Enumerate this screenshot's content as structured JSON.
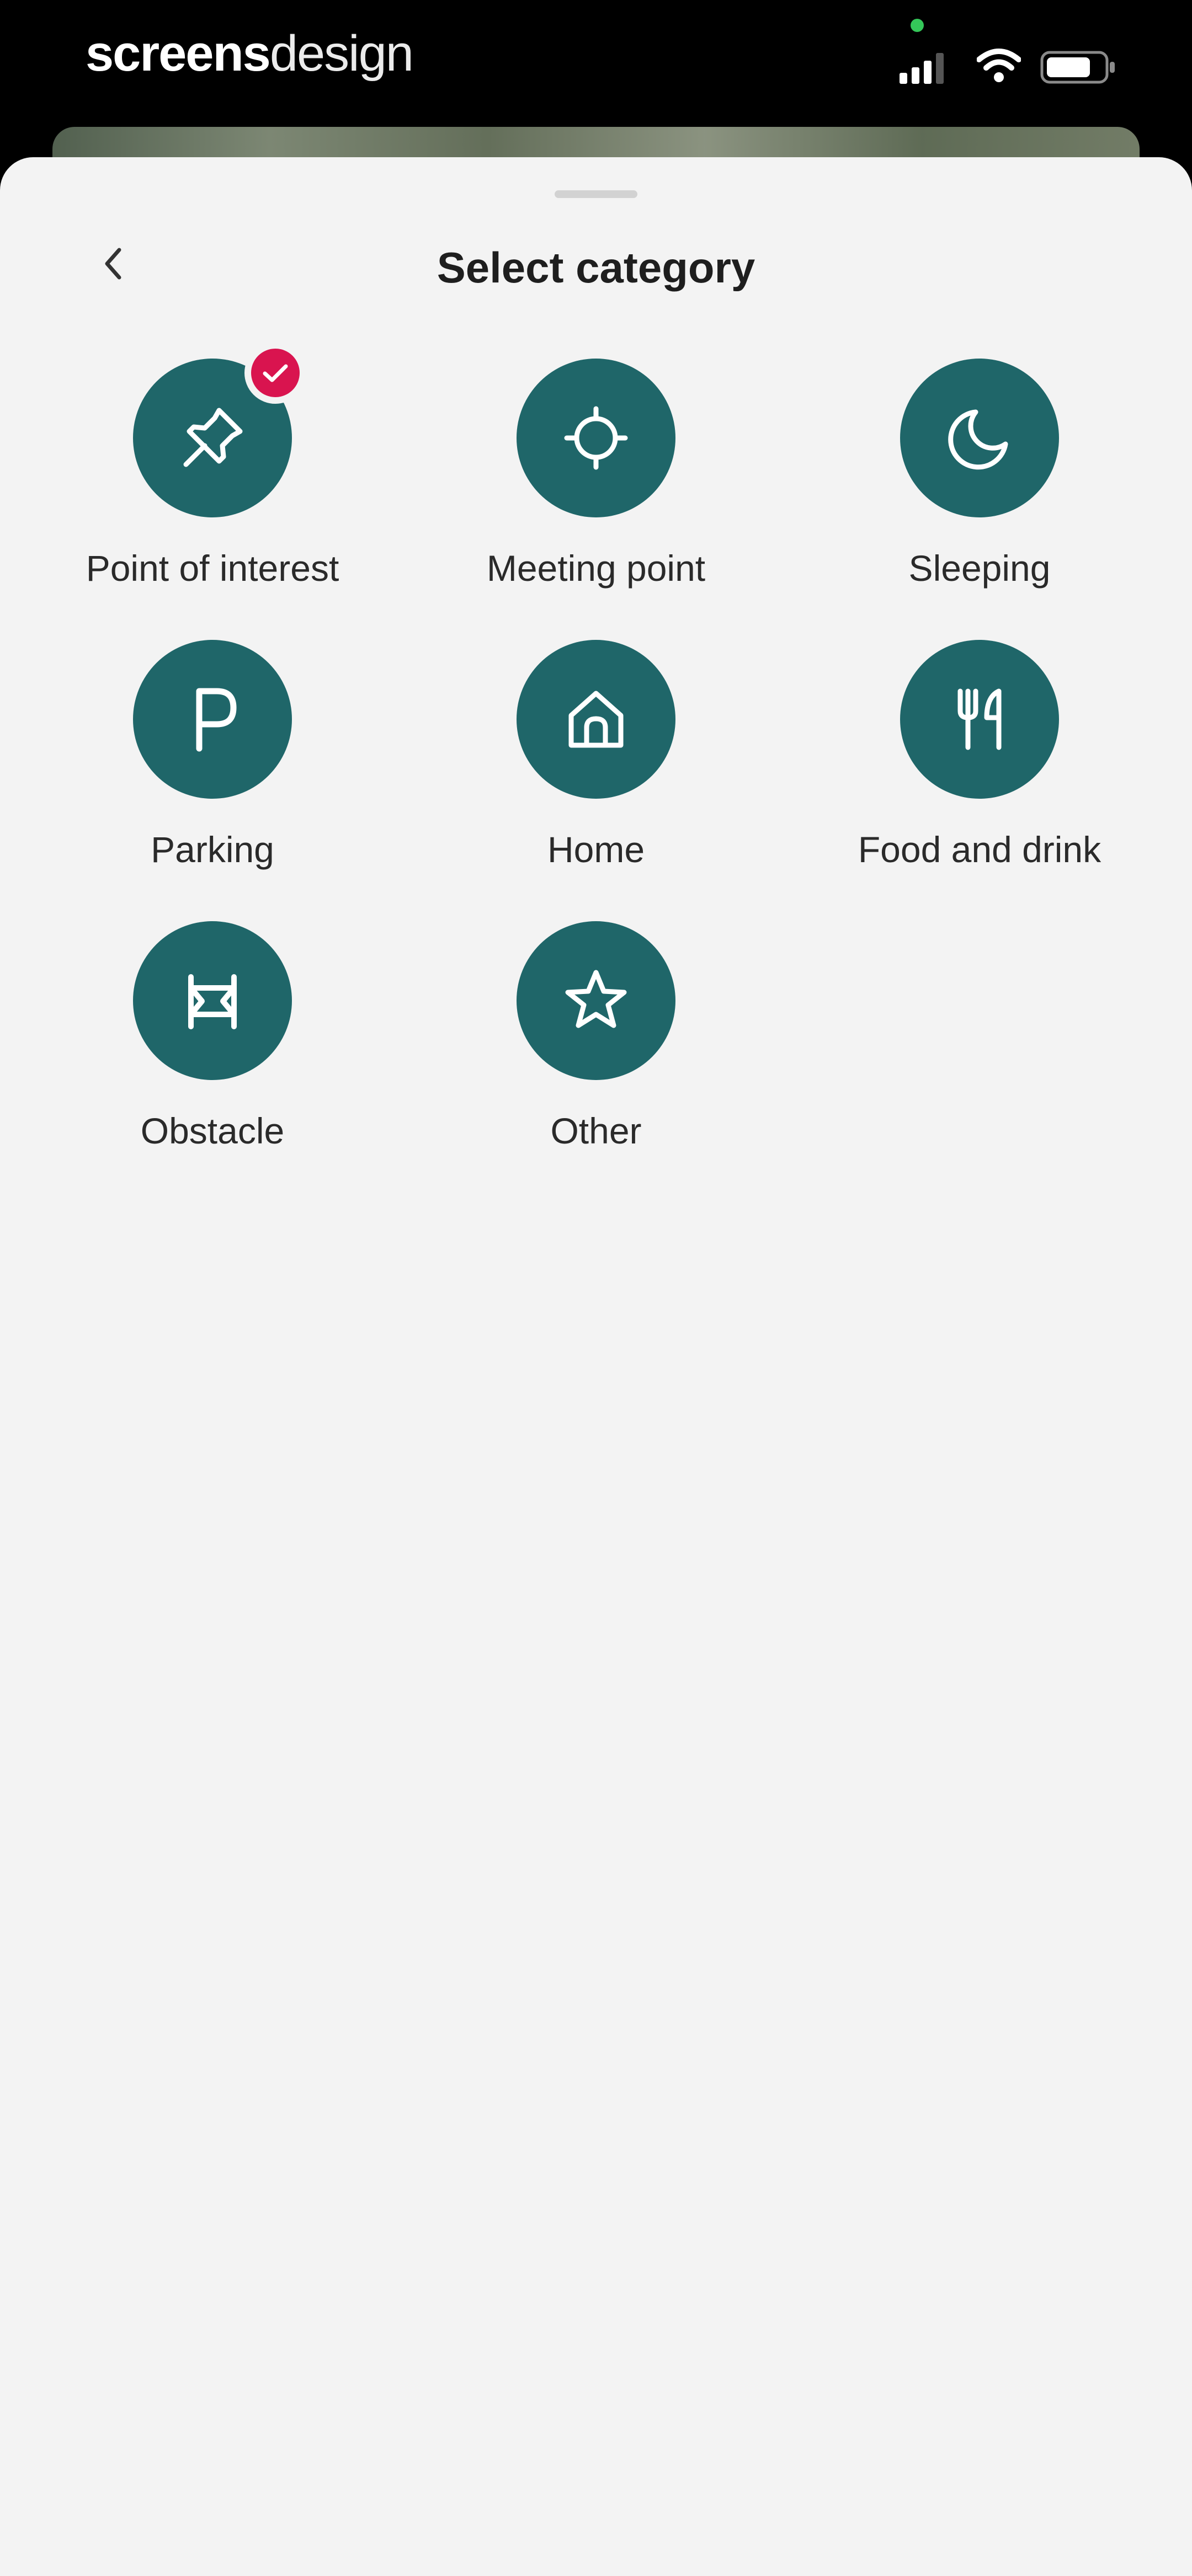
{
  "status_bar": {
    "brand_bold": "screens",
    "brand_light": "design",
    "icons": [
      "cellular-signal-icon",
      "wifi-icon",
      "battery-icon"
    ]
  },
  "sheet": {
    "title": "Select category",
    "back_icon": "chevron-left-icon"
  },
  "colors": {
    "accent": "#1f6669",
    "selected_badge": "#d9144f",
    "sheet_background": "#f3f3f3"
  },
  "categories": [
    {
      "label": "Point of interest",
      "icon": "pin-icon",
      "selected": true
    },
    {
      "label": "Meeting point",
      "icon": "target-icon",
      "selected": false
    },
    {
      "label": "Sleeping",
      "icon": "moon-icon",
      "selected": false
    },
    {
      "label": "Parking",
      "icon": "parking-icon",
      "selected": false
    },
    {
      "label": "Home",
      "icon": "home-icon",
      "selected": false
    },
    {
      "label": "Food and drink",
      "icon": "cutlery-icon",
      "selected": false
    },
    {
      "label": "Obstacle",
      "icon": "barrier-icon",
      "selected": false
    },
    {
      "label": "Other",
      "icon": "star-icon",
      "selected": false
    }
  ]
}
